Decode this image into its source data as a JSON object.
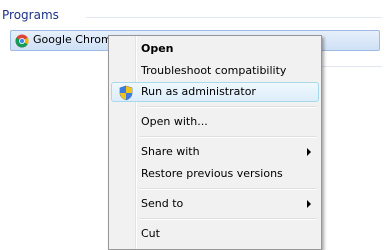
{
  "search_results": {
    "group_header": "Programs",
    "items": [
      {
        "label": "Google Chrome",
        "icon": "chrome-icon"
      }
    ]
  },
  "context_menu": {
    "items": [
      {
        "label": "Open",
        "bold": true
      },
      {
        "label": "Troubleshoot compatibility"
      },
      {
        "label": "Run as administrator",
        "icon": "uac-shield-icon",
        "highlighted": true
      },
      {
        "label": "Open with..."
      },
      {
        "label": "Share with",
        "has_submenu": true
      },
      {
        "label": "Restore previous versions"
      },
      {
        "label": "Send to",
        "has_submenu": true
      },
      {
        "label": "Cut"
      }
    ]
  },
  "colors": {
    "group_header": "#1e3287",
    "selection_border": "#9fbbe4",
    "menu_background": "#f1f1f1",
    "menu_highlight_border": "#a8d8eb"
  }
}
